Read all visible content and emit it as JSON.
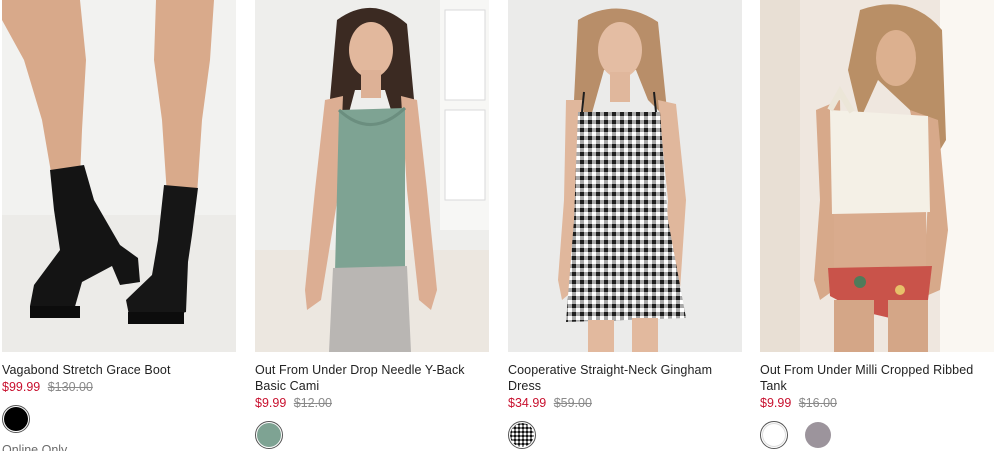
{
  "products": [
    {
      "title": "Vagabond Stretch Grace Boot",
      "price_sale": "$99.99",
      "price_original": "$130.00",
      "badge": "Online Only",
      "swatches": [
        {
          "name": "black",
          "color": "#000000",
          "selected": true
        }
      ]
    },
    {
      "title": "Out From Under Drop Needle Y-Back Basic Cami",
      "price_sale": "$9.99",
      "price_original": "$12.00",
      "swatches": [
        {
          "name": "sage",
          "color": "#7ea393",
          "selected": true
        }
      ]
    },
    {
      "title": "Cooperative Straight-Neck Gingham Dress",
      "price_sale": "$34.99",
      "price_original": "$59.00",
      "swatches": [
        {
          "name": "gingham",
          "color": "#2a2a2a",
          "selected": true
        }
      ]
    },
    {
      "title": "Out From Under Milli Cropped Ribbed Tank",
      "price_sale": "$9.99",
      "price_original": "$16.00",
      "swatches": [
        {
          "name": "ivory",
          "color": "#ffffff",
          "selected": true
        },
        {
          "name": "mauve",
          "color": "#9c949c",
          "selected": false
        }
      ]
    }
  ],
  "colors": {
    "sale_price": "#c8102e",
    "original_price": "#8a8a8a",
    "title_text": "#222222"
  }
}
